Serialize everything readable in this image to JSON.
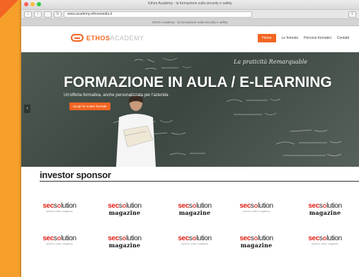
{
  "browser": {
    "window_title": "Ethos Academy - la formazione sulla security e safety",
    "url": "www.academy.ethosmedia.it",
    "tab_title": "Ethos Academy - la formazione sulla security e safety",
    "traffic_colors": [
      "#fc605c",
      "#fdbc40",
      "#34c84a"
    ],
    "back_label": "‹",
    "forward_label": "›",
    "reload_label": "↻",
    "share_label": "⇪"
  },
  "site": {
    "logo_part_a": "ETHOS",
    "logo_part_b": "ACADEMY",
    "nav": [
      "Home",
      "Le formule",
      "Percorsi formativi",
      "Contatti"
    ],
    "accent": "#f26522"
  },
  "hero": {
    "title": "FORMAZIONE IN AULA / E-LEARNING",
    "subtitle": "Un'offerta formativa, anche personalizzata per l'azienda",
    "button": "Scopri le nostre formule",
    "prev_arrow": "‹",
    "chalk_text": "La praticità Remarquable"
  },
  "sponsors": {
    "heading": "investor sponsor",
    "sec": "sec",
    "sol_a": "s",
    "sol_b": "lution",
    "magazine": "magazine",
    "tagline": "security online magazine",
    "items": [
      {
        "variant": "tagline"
      },
      {
        "variant": "magazine"
      },
      {
        "variant": "magazine"
      },
      {
        "variant": "tagline"
      },
      {
        "variant": "magazine"
      },
      {
        "variant": "tagline"
      },
      {
        "variant": "magazine"
      },
      {
        "variant": "tagline"
      },
      {
        "variant": "magazine"
      },
      {
        "variant": "tagline"
      }
    ]
  }
}
